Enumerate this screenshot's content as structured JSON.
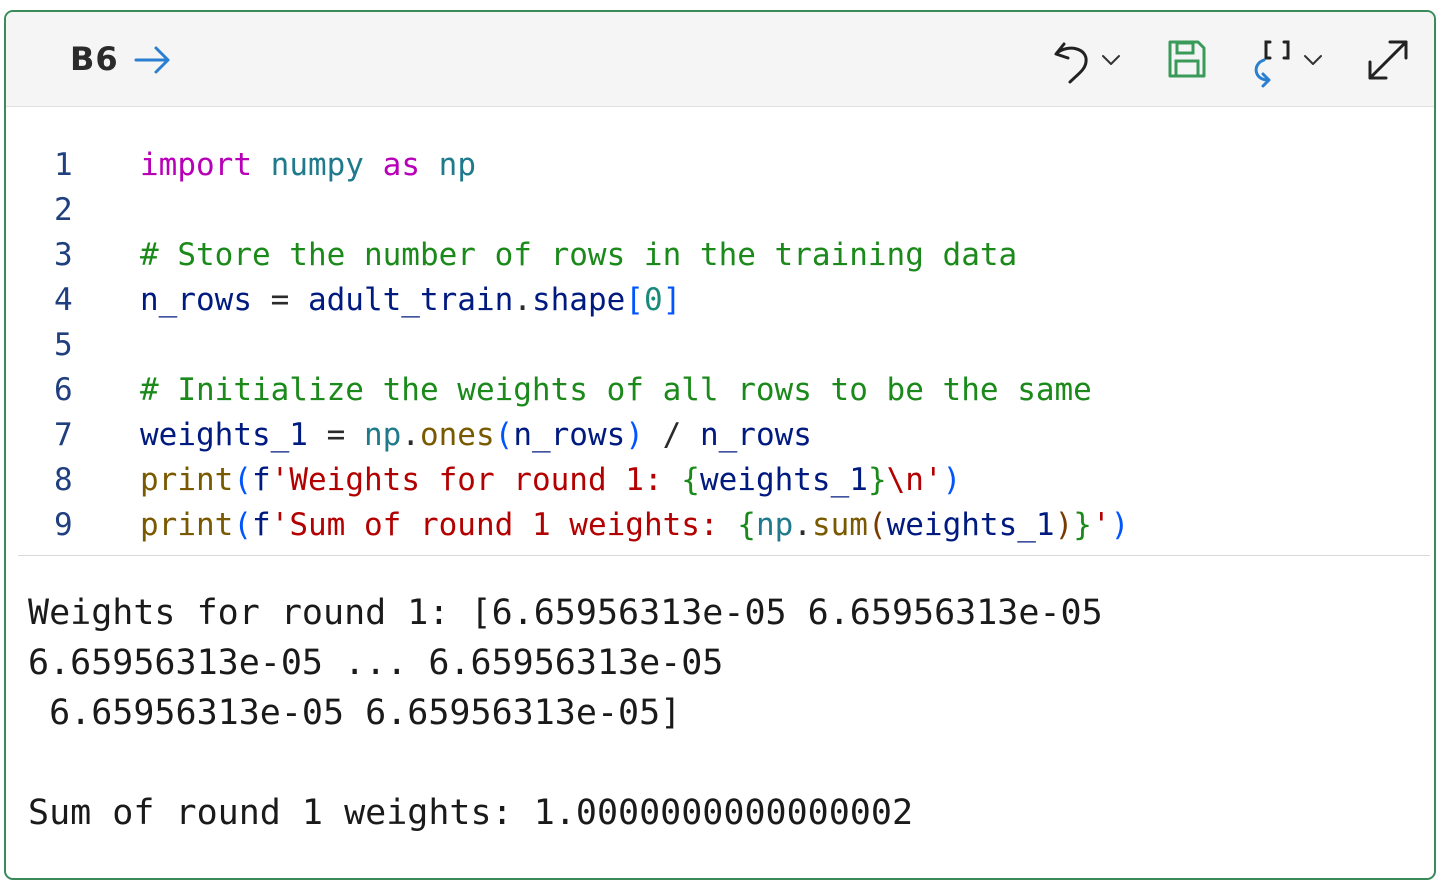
{
  "header": {
    "cell_reference": "B6",
    "icons": {
      "go_to_cell": "arrow-right-icon",
      "undo": "undo-icon",
      "undo_dropdown": "chevron-down-icon",
      "save": "save-icon",
      "reset": "reset-brackets-icon",
      "reset_dropdown": "chevron-down-icon",
      "expand": "expand-icon"
    },
    "colors": {
      "border": "#3a8a5a",
      "save_icon": "#3a9a5a",
      "arrow": "#2a7fd0"
    }
  },
  "code": {
    "lines": [
      {
        "number": "1",
        "tokens": [
          {
            "t": "import",
            "c": "kw"
          },
          {
            "t": " ",
            "c": "op"
          },
          {
            "t": "numpy",
            "c": "mod"
          },
          {
            "t": " ",
            "c": "op"
          },
          {
            "t": "as",
            "c": "kw"
          },
          {
            "t": " ",
            "c": "op"
          },
          {
            "t": "np",
            "c": "mod"
          }
        ]
      },
      {
        "number": "2",
        "tokens": []
      },
      {
        "number": "3",
        "tokens": [
          {
            "t": "# Store the number of rows in the training data",
            "c": "cmt"
          }
        ]
      },
      {
        "number": "4",
        "tokens": [
          {
            "t": "n_rows",
            "c": "var"
          },
          {
            "t": " = ",
            "c": "op"
          },
          {
            "t": "adult_train",
            "c": "var"
          },
          {
            "t": ".",
            "c": "op"
          },
          {
            "t": "shape",
            "c": "var"
          },
          {
            "t": "[",
            "c": "br1"
          },
          {
            "t": "0",
            "c": "num"
          },
          {
            "t": "]",
            "c": "br1"
          }
        ]
      },
      {
        "number": "5",
        "tokens": []
      },
      {
        "number": "6",
        "tokens": [
          {
            "t": "# Initialize the weights of all rows to be the same",
            "c": "cmt"
          }
        ]
      },
      {
        "number": "7",
        "tokens": [
          {
            "t": "weights_1",
            "c": "var"
          },
          {
            "t": " = ",
            "c": "op"
          },
          {
            "t": "np",
            "c": "mod"
          },
          {
            "t": ".",
            "c": "op"
          },
          {
            "t": "ones",
            "c": "fn"
          },
          {
            "t": "(",
            "c": "br1"
          },
          {
            "t": "n_rows",
            "c": "var"
          },
          {
            "t": ")",
            "c": "br1"
          },
          {
            "t": " / ",
            "c": "op"
          },
          {
            "t": "n_rows",
            "c": "var"
          }
        ]
      },
      {
        "number": "8",
        "tokens": [
          {
            "t": "print",
            "c": "fn"
          },
          {
            "t": "(",
            "c": "br1"
          },
          {
            "t": "f",
            "c": "var"
          },
          {
            "t": "'Weights for round 1: ",
            "c": "str"
          },
          {
            "t": "{",
            "c": "br2"
          },
          {
            "t": "weights_1",
            "c": "var"
          },
          {
            "t": "}",
            "c": "br2"
          },
          {
            "t": "\\n",
            "c": "esc"
          },
          {
            "t": "'",
            "c": "str"
          },
          {
            "t": ")",
            "c": "br1"
          }
        ]
      },
      {
        "number": "9",
        "tokens": [
          {
            "t": "print",
            "c": "fn"
          },
          {
            "t": "(",
            "c": "br1"
          },
          {
            "t": "f",
            "c": "var"
          },
          {
            "t": "'Sum of round 1 weights: ",
            "c": "str"
          },
          {
            "t": "{",
            "c": "br2"
          },
          {
            "t": "np",
            "c": "mod"
          },
          {
            "t": ".",
            "c": "op"
          },
          {
            "t": "sum",
            "c": "fn"
          },
          {
            "t": "(",
            "c": "br3"
          },
          {
            "t": "weights_1",
            "c": "var"
          },
          {
            "t": ")",
            "c": "br3"
          },
          {
            "t": "}",
            "c": "br2"
          },
          {
            "t": "'",
            "c": "str"
          },
          {
            "t": ")",
            "c": "br1"
          }
        ]
      }
    ]
  },
  "output": {
    "lines": [
      "Weights for round 1: [6.65956313e-05 6.65956313e-05",
      "6.65956313e-05 ... 6.65956313e-05",
      " 6.65956313e-05 6.65956313e-05]",
      "",
      "Sum of round 1 weights: 1.0000000000000002"
    ]
  }
}
